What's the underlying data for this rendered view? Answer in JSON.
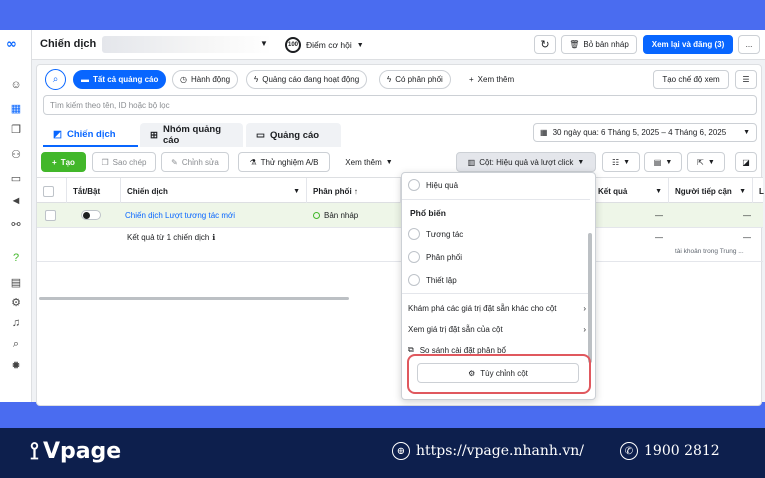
{
  "header": {
    "title": "Chiến dịch",
    "score_value": "100",
    "score_label": "Điểm cơ hội",
    "drafts_label": "Bỏ bản nháp",
    "review_publish_label": "Xem lại và đăng (3)",
    "more_label": "..."
  },
  "filters": {
    "all_ads": "Tất cả quảng cáo",
    "actions": "Hành động",
    "active_ads": "Quảng cáo đang hoạt động",
    "delivering": "Có phân phối",
    "see_more": "Xem thêm",
    "create_view": "Tạo chế độ xem"
  },
  "search": {
    "placeholder": "Tìm kiếm theo tên, ID hoặc bộ lọc"
  },
  "tabs": [
    {
      "label": "Chiến dịch"
    },
    {
      "label": "Nhóm quảng cáo"
    },
    {
      "label": "Quảng cáo"
    }
  ],
  "date_range": "30 ngày qua: 6 Tháng 5, 2025 – 4 Tháng 6, 2025",
  "toolbar": {
    "create": "Tạo",
    "copy": "Sao chép",
    "edit": "Chỉnh sửa",
    "ab_test": "Thử nghiệm A/B",
    "see_more": "Xem thêm",
    "columns": "Cột: Hiệu quả và lượt click"
  },
  "table": {
    "headers": {
      "toggle": "Tắt/Bật",
      "campaign": "Chiến dịch",
      "delivery": "Phân phối ↑",
      "results": "Kết quả",
      "reach": "Người tiếp cận",
      "more": "L"
    },
    "row1": {
      "name": "Chiến dịch Lượt tương tác mới",
      "delivery": "Bản nháp",
      "results": "—",
      "reach": "—"
    },
    "summary": {
      "label": "Kết quả từ 1 chiến dịch",
      "results": "—",
      "reach": "—",
      "reach_note": "tài khoản trong Trung ..."
    }
  },
  "dropdown": {
    "top_item": "Hiệu quả",
    "section_popular": "Phổ biến",
    "popular_items": [
      "Tương tác",
      "Phân phối",
      "Thiết lập"
    ],
    "explore": "Khám phá các giá trị đặt sẵn khác cho cột",
    "view_presets": "Xem giá trị đặt sẵn của cột",
    "compare": "So sánh cài đặt phân bổ",
    "customize": "Tùy chỉnh cột"
  },
  "footer": {
    "brand": "Vpage",
    "website": "https://vpage.nhanh.vn/",
    "phone": "1900 2812"
  },
  "colors": {
    "accent": "#0866ff",
    "create_green": "#42b72a",
    "highlight_ring": "#e0585e",
    "footer_bg": "#0d1f4d",
    "outer_bg": "#4a6cf0"
  }
}
